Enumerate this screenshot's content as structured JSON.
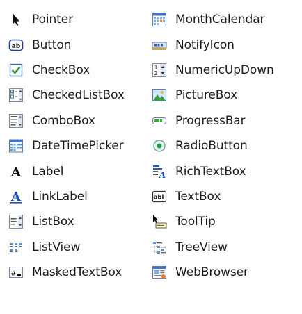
{
  "toolbox": {
    "left_items": [
      {
        "label": "Pointer",
        "icon": "pointer-icon"
      },
      {
        "label": "Button",
        "icon": "button-icon"
      },
      {
        "label": "CheckBox",
        "icon": "checkbox-icon"
      },
      {
        "label": "CheckedListBox",
        "icon": "checked-list-box-icon"
      },
      {
        "label": "ComboBox",
        "icon": "combo-box-icon"
      },
      {
        "label": "DateTimePicker",
        "icon": "date-time-picker-icon"
      },
      {
        "label": "Label",
        "icon": "label-icon"
      },
      {
        "label": "LinkLabel",
        "icon": "link-label-icon"
      },
      {
        "label": "ListBox",
        "icon": "list-box-icon"
      },
      {
        "label": "ListView",
        "icon": "list-view-icon"
      },
      {
        "label": "MaskedTextBox",
        "icon": "masked-text-box-icon"
      }
    ],
    "right_items": [
      {
        "label": "MonthCalendar",
        "icon": "month-calendar-icon"
      },
      {
        "label": "NotifyIcon",
        "icon": "notify-icon-icon"
      },
      {
        "label": "NumericUpDown",
        "icon": "numeric-up-down-icon"
      },
      {
        "label": "PictureBox",
        "icon": "picture-box-icon"
      },
      {
        "label": "ProgressBar",
        "icon": "progress-bar-icon"
      },
      {
        "label": "RadioButton",
        "icon": "radio-button-icon"
      },
      {
        "label": "RichTextBox",
        "icon": "rich-text-box-icon"
      },
      {
        "label": "TextBox",
        "icon": "text-box-icon"
      },
      {
        "label": "ToolTip",
        "icon": "tool-tip-icon"
      },
      {
        "label": "TreeView",
        "icon": "tree-view-icon"
      },
      {
        "label": "WebBrowser",
        "icon": "web-browser-icon"
      }
    ]
  }
}
